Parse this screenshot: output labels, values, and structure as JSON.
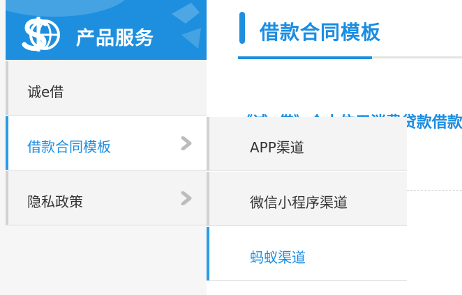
{
  "sidebar": {
    "brand_title": "产品服务",
    "items": [
      {
        "label": "诚e借",
        "active": false,
        "has_submenu": false
      },
      {
        "label": "借款合同模板",
        "active": true,
        "has_submenu": true
      },
      {
        "label": "隐私政策",
        "active": false,
        "has_submenu": true
      }
    ]
  },
  "main": {
    "title": "借款合同模板",
    "doc_link": "《诚e借》个人信用消费贷款借款合同"
  },
  "submenu": {
    "items": [
      {
        "label": "APP渠道",
        "active": false
      },
      {
        "label": "微信小程序渠道",
        "active": false
      },
      {
        "label": "蚂蚁渠道",
        "active": true
      }
    ]
  },
  "colors": {
    "brand_blue": "#1d8fde",
    "accent_text": "#1a8de3",
    "nav_bg": "#f4f4f4"
  },
  "icons": {
    "brand_logo": "dollar-globe-icon",
    "chevron": "chevron-right-icon"
  }
}
